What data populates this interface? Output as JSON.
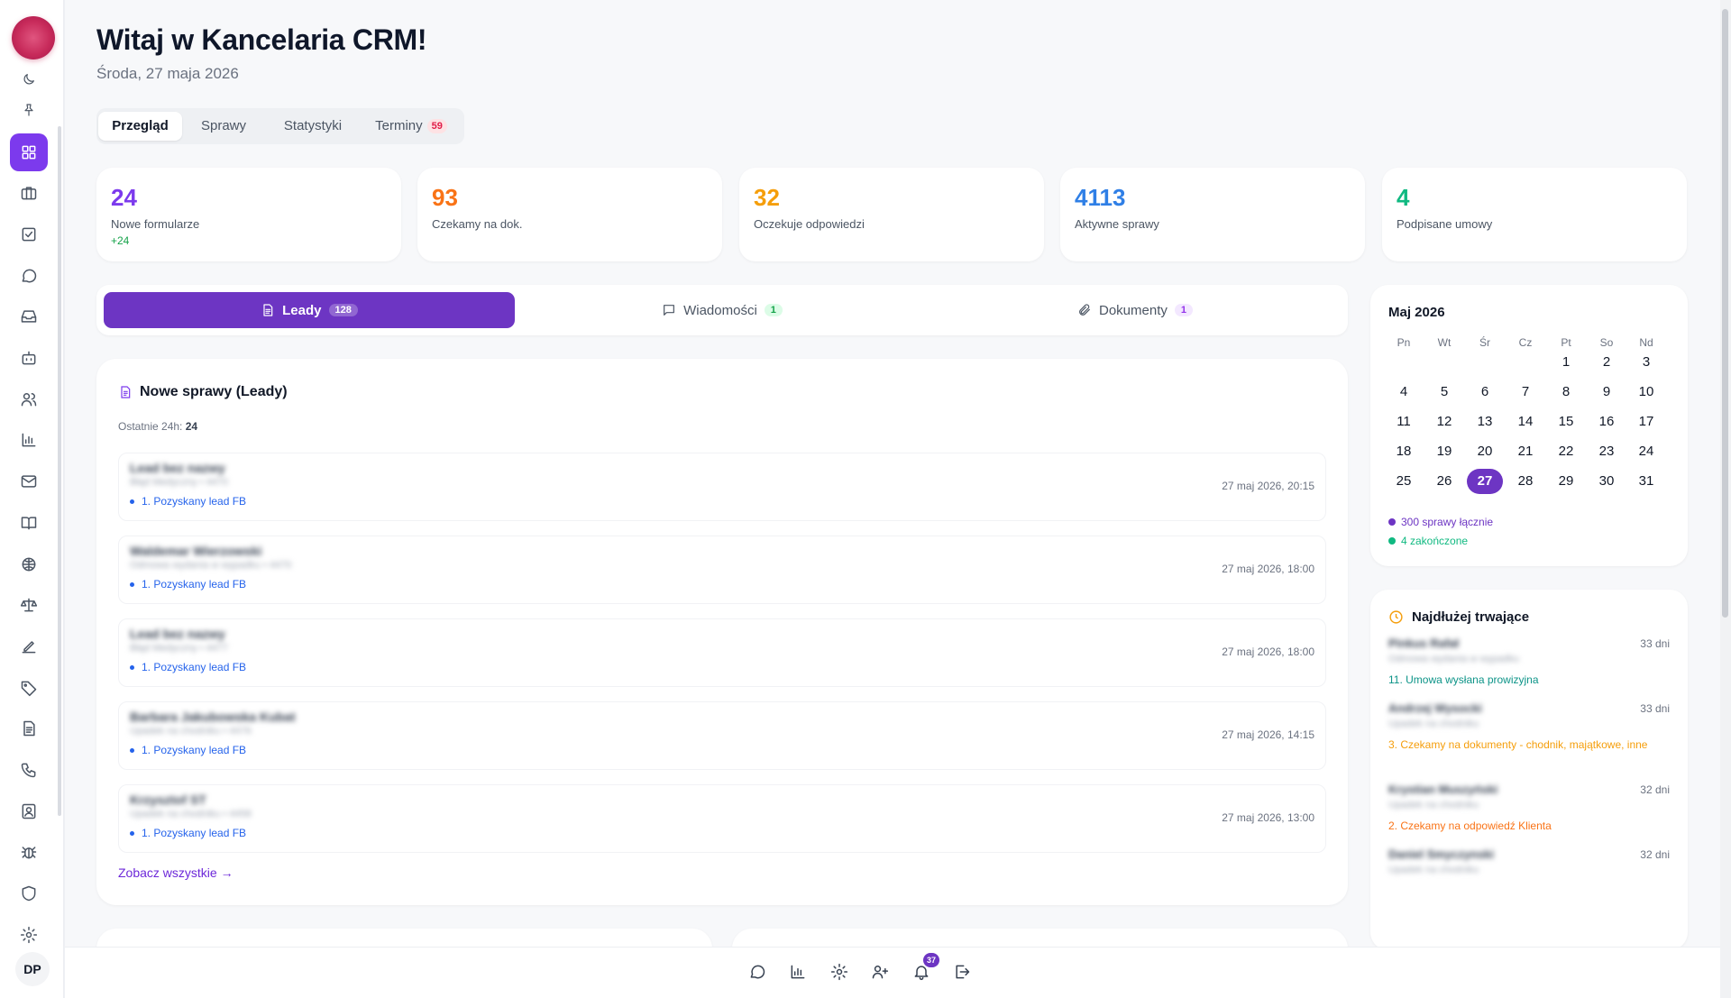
{
  "header": {
    "title": "Witaj w Kancelaria CRM!",
    "date": "Środa, 27 maja 2026"
  },
  "tabs": [
    {
      "label": "Przegląd",
      "active": true
    },
    {
      "label": "Sprawy"
    },
    {
      "label": "Statystyki"
    },
    {
      "label": "Terminy",
      "badge": "59"
    }
  ],
  "stats": [
    {
      "value": "24",
      "label": "Nowe formularze",
      "sub": "+24",
      "color": "#7c3aed"
    },
    {
      "value": "93",
      "label": "Czekamy na dok.",
      "color": "#f97316"
    },
    {
      "value": "32",
      "label": "Oczekuje odpowiedzi",
      "color": "#f59e0b"
    },
    {
      "value": "4113",
      "label": "Aktywne sprawy",
      "color": "#2f7fe6"
    },
    {
      "value": "4",
      "label": "Podpisane umowy",
      "color": "#10b981"
    }
  ],
  "segments": [
    {
      "label": "Leady",
      "count": "128",
      "icon": "document-icon",
      "active": true
    },
    {
      "label": "Wiadomości",
      "count": "1",
      "icon": "message-icon"
    },
    {
      "label": "Dokumenty",
      "count": "1",
      "icon": "paperclip-icon"
    }
  ],
  "leads": {
    "title": "Nowe sprawy (Leady)",
    "sub_label": "Ostatnie 24h:",
    "sub_value": "24",
    "items": [
      {
        "name": "Lead bez nazwy",
        "desc": "Błąd Medyczny • 4470",
        "stage": "1. Pozyskany lead FB",
        "date": "27 maj 2026, 20:15"
      },
      {
        "name": "Waldemar Wierzowski",
        "desc": "Odmowa wydania w wypadku • 4470",
        "stage": "1. Pozyskany lead FB",
        "date": "27 maj 2026, 18:00"
      },
      {
        "name": "Lead bez nazwy",
        "desc": "Błąd Medyczny • 4477",
        "stage": "1. Pozyskany lead FB",
        "date": "27 maj 2026, 18:00"
      },
      {
        "name": "Barbara Jakubowska Kubat",
        "desc": "Upadek na chodniku • 4476",
        "stage": "1. Pozyskany lead FB",
        "date": "27 maj 2026, 14:15"
      },
      {
        "name": "Krzysztof ST",
        "desc": "Upadek na chodniku • 4458",
        "stage": "1. Pozyskany lead FB",
        "date": "27 maj 2026, 13:00"
      }
    ],
    "see_all": "Zobacz wszystkie →"
  },
  "calendar": {
    "title": "Maj 2026",
    "weekdays": [
      "Pn",
      "Wt",
      "Śr",
      "Cz",
      "Pt",
      "So",
      "Nd"
    ],
    "first_weekday_index": 4,
    "days_in_month": 31,
    "today": 27,
    "legend": [
      {
        "text": "300 sprawy łącznie",
        "color": "#6d35c3"
      },
      {
        "text": "4 zakończone",
        "color": "#10b981"
      }
    ]
  },
  "longest": {
    "title": "Najdłużej trwające",
    "items": [
      {
        "name": "Pinkus Rafał",
        "desc": "Odmowa wydania w wypadku",
        "days": "33 dni",
        "stage": "11. Umowa wysłana prowizyjna",
        "stage_color": "#0d9488"
      },
      {
        "name": "Andrzej Wysocki",
        "desc": "Upadek na chodniku",
        "days": "33 dni",
        "stage": "3. Czekamy na dokumenty - chodnik, majątkowe, inne",
        "stage_color": "#f59e0b"
      },
      {
        "name": "Krystian Muszyński",
        "desc": "Upadek na chodniku",
        "days": "32 dni",
        "stage": "2. Czekamy na odpowiedź Klienta",
        "stage_color": "#f97316"
      },
      {
        "name": "Daniel Smyczynski",
        "desc": "Upadek na chodniku",
        "days": "32 dni",
        "stage": "",
        "stage_color": "#f97316"
      }
    ]
  },
  "user": {
    "initials": "DP"
  },
  "dock": {
    "notifications_badge": "37"
  },
  "colors": {
    "accent": "#6d35c3",
    "logo": "#c72a5a"
  }
}
